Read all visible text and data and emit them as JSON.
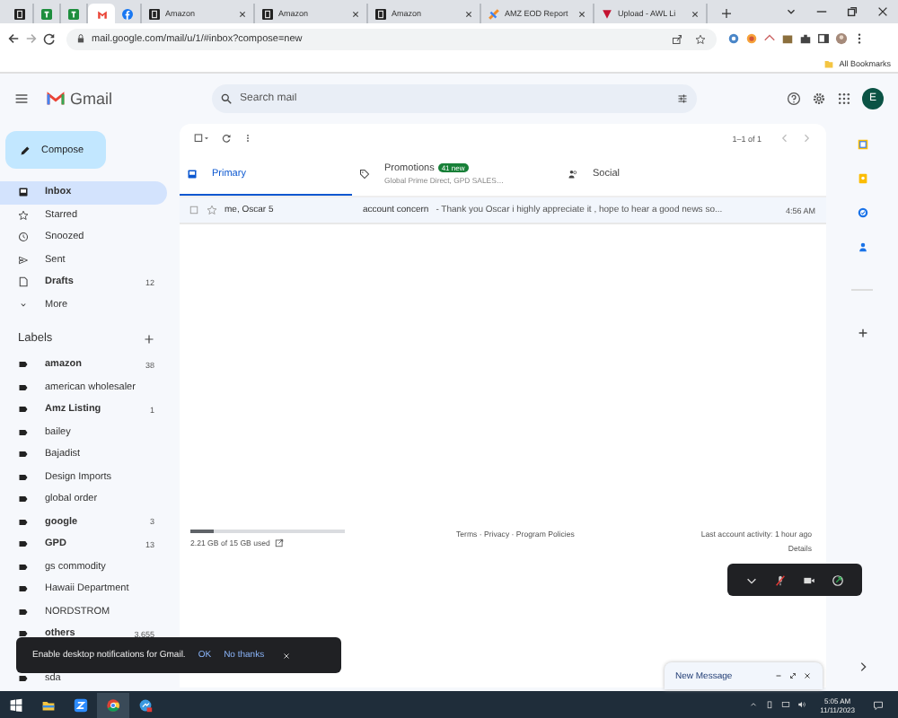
{
  "browser": {
    "tabs": [
      {
        "kind": "amazon",
        "selected": false
      },
      {
        "kind": "sheets",
        "selected": false
      },
      {
        "kind": "sheets",
        "selected": false
      },
      {
        "kind": "gmail",
        "selected": true
      },
      {
        "kind": "facebook",
        "selected": false
      },
      {
        "kind": "amazon",
        "label": "Amazon",
        "selected": false
      },
      {
        "kind": "amazon",
        "label": "Amazon",
        "selected": false
      },
      {
        "kind": "amazon",
        "label": "Amazon",
        "selected": false
      },
      {
        "kind": "report",
        "label": "AMZ EOD Report",
        "selected": false
      },
      {
        "kind": "upload",
        "label": "Upload - AWL Li",
        "selected": false
      }
    ],
    "address": "mail.google.com/mail/u/1/#inbox?compose=new",
    "bookmarks": "All Bookmarks"
  },
  "header": {
    "logo": "Gmail",
    "search": {
      "placeholder": "Search mail"
    },
    "avatar": "E"
  },
  "sidebar": {
    "compose": "Compose",
    "items": [
      {
        "kind": "inbox",
        "label": "Inbox",
        "selected": true,
        "bold": true
      },
      {
        "kind": "star",
        "label": "Starred",
        "selected": false,
        "bold": false
      },
      {
        "kind": "clock",
        "label": "Snoozed",
        "selected": false,
        "bold": false
      },
      {
        "kind": "send",
        "label": "Sent",
        "selected": false,
        "bold": false
      },
      {
        "kind": "draft",
        "label": "Drafts",
        "count": "12",
        "selected": false,
        "bold": true
      },
      {
        "kind": "more",
        "label": "More",
        "selected": false,
        "bold": false
      }
    ],
    "labels_title": "Labels",
    "labels": [
      {
        "name": "amazon",
        "count": "38",
        "bold": true
      },
      {
        "name": "american wholesaler",
        "bold": false
      },
      {
        "name": "Amz Listing",
        "count": "1",
        "bold": true
      },
      {
        "name": "bailey",
        "bold": false
      },
      {
        "name": "Bajadist",
        "bold": false
      },
      {
        "name": "Design Imports",
        "bold": false
      },
      {
        "name": "global order",
        "bold": false
      },
      {
        "name": "google",
        "count": "3",
        "bold": true
      },
      {
        "name": "GPD",
        "count": "13",
        "bold": true
      },
      {
        "name": "gs commodity",
        "bold": false
      },
      {
        "name": "Hawaii Department",
        "bold": false
      },
      {
        "name": "NORDSTROM",
        "bold": false
      },
      {
        "name": "others",
        "count": "3,655",
        "bold": true
      },
      {
        "name": "sda",
        "bold": false
      }
    ]
  },
  "toolbar": {
    "select_all": {
      "checked": false
    },
    "pagination": "1–1 of 1"
  },
  "categories": [
    {
      "kind": "primary",
      "label": "Primary",
      "selected": true
    },
    {
      "kind": "promotions",
      "label": "Promotions",
      "badge": "41 new",
      "sub": "Global Prime Direct, GPD SALES…",
      "selected": false
    },
    {
      "kind": "social",
      "label": "Social",
      "selected": false
    }
  ],
  "emails": [
    {
      "sender": "me, Oscar 5",
      "subject": "account concern",
      "snippet": "- Thank you Oscar i highly appreciate it , hope to hear a good news so...",
      "time": "4:56 AM",
      "unread": false,
      "checked": false,
      "starred": false
    }
  ],
  "storage": {
    "text": "2.21 GB of 15 GB used",
    "level": 0.15
  },
  "footer": {
    "links": "Terms · Privacy · Program Policies",
    "activity": "Last account activity: 1 hour ago",
    "details": "Details"
  },
  "toast": {
    "text": "Enable desktop notifications for Gmail.",
    "ok": "OK",
    "no": "No thanks"
  },
  "compose_window": {
    "title": "New Message"
  },
  "taskbar": {
    "time": "5:05 AM",
    "date": "11/11/2023"
  }
}
